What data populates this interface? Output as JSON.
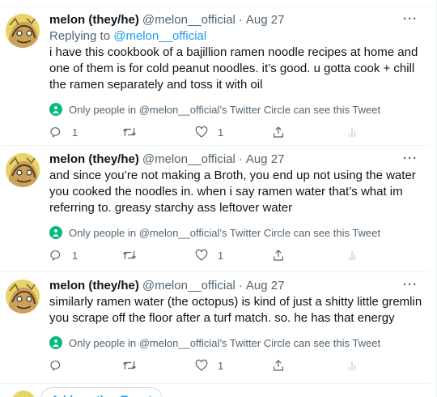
{
  "tweets": [
    {
      "name": "melon (they/he)",
      "handle": "@melon__official",
      "separator": "·",
      "date": "Aug 27",
      "more": "···",
      "replying_prefix": "Replying to ",
      "replying_handle": "@melon__official",
      "text": "i have this cookbook of a bajillion ramen noodle recipes at home and one of them is for cold peanut noodles. it’s good. u gotta cook + chill the ramen separately and toss it with oil",
      "circle_notice": "Only people in @melon__official’s Twitter Circle can see this Tweet",
      "reply_count": "1",
      "retweet_count": "",
      "like_count": "1"
    },
    {
      "name": "melon (they/he)",
      "handle": "@melon__official",
      "separator": "·",
      "date": "Aug 27",
      "more": "···",
      "text": "and since you’re not making a Broth, you end up not using the water you cooked the noodles in. when i say ramen water that’s what im referring to. greasy starchy ass leftover water",
      "circle_notice": "Only people in @melon__official’s Twitter Circle can see this Tweet",
      "reply_count": "1",
      "retweet_count": "",
      "like_count": "1"
    },
    {
      "name": "melon (they/he)",
      "handle": "@melon__official",
      "separator": "·",
      "date": "Aug 27",
      "more": "···",
      "text": "similarly ramen water (the octopus) is kind of just a shitty little gremlin you scrape off the floor after a turf match. so. he has that energy",
      "circle_notice": "Only people in @melon__official’s Twitter Circle can see this Tweet",
      "reply_count": "",
      "retweet_count": "",
      "like_count": "1"
    }
  ],
  "composer": {
    "add_another_label": "Add another Tweet"
  },
  "colors": {
    "accent": "#1d9bf0",
    "muted": "#536471",
    "circle_green": "#00ba7c",
    "avatar_bg": "#e8d36a"
  },
  "icons": [
    "reply-icon",
    "retweet-icon",
    "like-icon",
    "share-icon",
    "analytics-icon",
    "twitter-circle-icon",
    "more-icon"
  ]
}
